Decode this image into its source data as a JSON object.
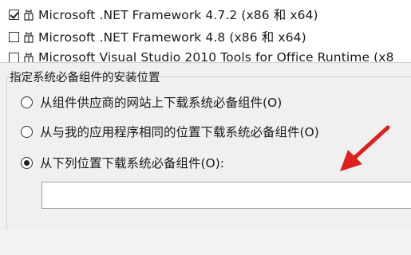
{
  "components": [
    {
      "checked": true,
      "label": "Microsoft .NET Framework 4.7.2 (x86 和 x64)",
      "icon": "package-icon"
    },
    {
      "checked": false,
      "label": "Microsoft .NET Framework 4.8 (x86 和 x64)",
      "icon": "package-icon"
    },
    {
      "checked": false,
      "label": "Microsoft Visual Studio 2010 Tools for Office Runtime (x8",
      "icon": "package-icon"
    }
  ],
  "install_location": {
    "group_title": "指定系统必备组件的安装位置",
    "options": [
      {
        "label": "从组件供应商的网站上下载系统必备组件(O)",
        "selected": false
      },
      {
        "label": "从与我的应用程序相同的位置下载系统必备组件(O)",
        "selected": false
      },
      {
        "label": "从下列位置下载系统必备组件(O):",
        "selected": true
      }
    ],
    "path_value": "",
    "path_placeholder": ""
  },
  "annotation": {
    "color": "#e02020",
    "icon": "red-arrow-icon"
  }
}
